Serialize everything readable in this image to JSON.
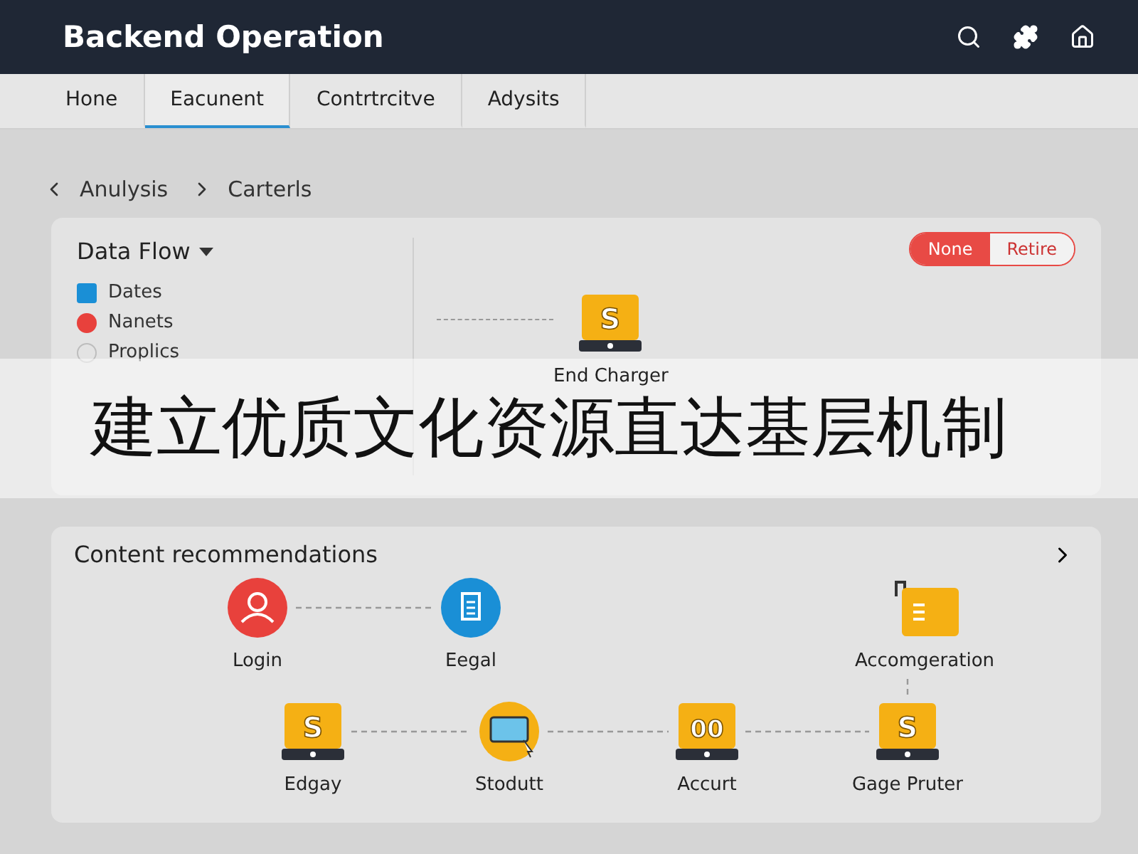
{
  "header": {
    "title": "Backend Operation"
  },
  "tabs": [
    {
      "label": "Hone",
      "selected": false
    },
    {
      "label": "Eacunent",
      "selected": true
    },
    {
      "label": "Contrtrcitve",
      "selected": false
    },
    {
      "label": "Adysits",
      "selected": false
    }
  ],
  "breadcrumb": [
    "Anulysis",
    "Carterls"
  ],
  "data_flow": {
    "title": "Data Flow",
    "legend": [
      {
        "label": "Dates",
        "kind": "square",
        "color": "#1a8fd6"
      },
      {
        "label": "Nanets",
        "kind": "dot",
        "color": "#e8413c"
      },
      {
        "label": "Proplics",
        "kind": "ring",
        "color": "#bdbdbd"
      }
    ],
    "toggle": [
      {
        "label": "None",
        "selected": true
      },
      {
        "label": "Retire",
        "selected": false
      }
    ],
    "node": {
      "label": "End Charger",
      "kind": "dollar",
      "icon_text": "S"
    }
  },
  "recommendations": {
    "title": "Content recommendations",
    "nodes": [
      {
        "label": "Login",
        "kind": "user"
      },
      {
        "label": "Eegal",
        "kind": "doc"
      },
      {
        "label": "Accomgeration",
        "kind": "folder"
      },
      {
        "label": "Edgay",
        "kind": "dollar",
        "icon_text": "S"
      },
      {
        "label": "Stodutt",
        "kind": "monitor"
      },
      {
        "label": "Accurt",
        "kind": "counter",
        "icon_text": "00"
      },
      {
        "label": "Gage Pruter",
        "kind": "dollar",
        "icon_text": "S"
      }
    ]
  },
  "banner": {
    "text": "建立优质文化资源直达基层机制"
  }
}
